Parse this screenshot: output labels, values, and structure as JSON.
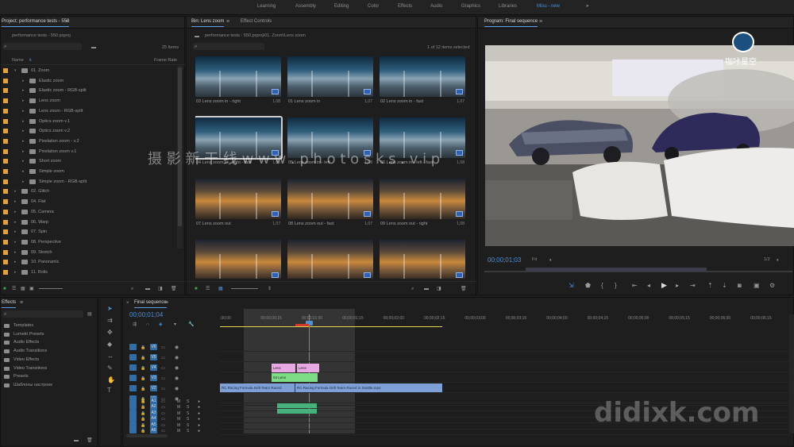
{
  "workspaces": [
    "Learning",
    "Assembly",
    "Editing",
    "Color",
    "Effects",
    "Audio",
    "Graphics",
    "Libraries",
    "Misu - new"
  ],
  "workspace_more": "»",
  "project": {
    "tab": "Project: performance tests - 550",
    "file": "performance tests - 550.prproj",
    "items_count": "25 Items",
    "col_name": "Name",
    "col_rate": "Frame Rate",
    "rows": [
      {
        "label": "01. Zoom",
        "level": 0,
        "open": true
      },
      {
        "label": "Elastic zoom",
        "level": 1
      },
      {
        "label": "Elastic zoom - RGB-split",
        "level": 1
      },
      {
        "label": "Lens zoom",
        "level": 1
      },
      {
        "label": "Lens zoom - RGB-split",
        "level": 1
      },
      {
        "label": "Optics zoom v.1",
        "level": 1
      },
      {
        "label": "Optics zoom v.2",
        "level": 1
      },
      {
        "label": "Pixelation zoom - v.2",
        "level": 1
      },
      {
        "label": "Pixelation zoom v.1",
        "level": 1
      },
      {
        "label": "Short zoom",
        "level": 1
      },
      {
        "label": "Simple zoom",
        "level": 1
      },
      {
        "label": "Simple zoom - RGB-split",
        "level": 1
      },
      {
        "label": "02. Glitch",
        "level": 0
      },
      {
        "label": "04. Flat",
        "level": 0
      },
      {
        "label": "05. Camera",
        "level": 0
      },
      {
        "label": "06. Warp",
        "level": 0
      },
      {
        "label": "07. Spin",
        "level": 0
      },
      {
        "label": "08. Perspective",
        "level": 0
      },
      {
        "label": "09. Stretch",
        "level": 0
      },
      {
        "label": "10. Panoramic",
        "level": 0
      },
      {
        "label": "11. Rolls",
        "level": 0
      }
    ]
  },
  "bin": {
    "tab": "Bin: Lens zoom",
    "tab2": "Effect Controls",
    "path": "performance tests - 550.prproj\\01. Zoom\\Lens zoom",
    "selected": "1 of 12 items selected",
    "thumbs": [
      {
        "caption": "03 Lens zoom in - right",
        "dur": "1,08",
        "style": "day"
      },
      {
        "caption": "01 Lens zoom in",
        "dur": "1,07",
        "style": "day"
      },
      {
        "caption": "02 Lens zoom in - fast",
        "dur": "1,07",
        "style": "day"
      },
      {
        "caption": "04 Lens zoom in - right - fast",
        "dur": "1,08",
        "style": "day",
        "selected": true
      },
      {
        "caption": "05 Lens zoom in - left",
        "dur": "1,08",
        "style": "day"
      },
      {
        "caption": "06 Lens zoom in - left - fast",
        "dur": "1,08",
        "style": "day"
      },
      {
        "caption": "07 Lens zoom out",
        "dur": "1,07",
        "style": "night"
      },
      {
        "caption": "08 Lens zoom out - fast",
        "dur": "1,07",
        "style": "night"
      },
      {
        "caption": "09 Lens zoom out - right",
        "dur": "1,08",
        "style": "night"
      },
      {
        "caption": "",
        "dur": "",
        "style": "night"
      },
      {
        "caption": "",
        "dur": "",
        "style": "night"
      },
      {
        "caption": "",
        "dur": "",
        "style": "night"
      }
    ]
  },
  "program": {
    "tab": "Program: Final sequence",
    "timecode": "00;00;01;03",
    "fit": "Fit",
    "resolution": "1/2"
  },
  "effects": {
    "tab": "Effects",
    "items": [
      "Templates",
      "Lumetri Presets",
      "Audio Effects",
      "Audio Transitions",
      "Video Effects",
      "Video Transitions",
      "Presets",
      "Шаблоны настроек"
    ]
  },
  "timeline": {
    "tab": "Final sequence",
    "timecode": "00;00;01;04",
    "ruler": [
      ";00;00",
      "00;00;00;15",
      "00;00;01;00",
      "00;00;01;15",
      "00;00;02;00",
      "00;00;02;15",
      "00;00;03;00",
      "00;00;03;15",
      "00;00;04;00",
      "00;00;04;15",
      "00;00;05;00",
      "00;00;05;15",
      "00;00;06;00",
      "00;00;06;15",
      "00;00;07;00"
    ],
    "video_tracks": [
      "V6",
      "V5",
      "V4",
      "V3",
      "V2",
      "V1"
    ],
    "audio_tracks": [
      "A1",
      "A2",
      "A3",
      "A4",
      "A5",
      "A6"
    ],
    "clip_lens_a": "Lens",
    "clip_lens_b": "Lens",
    "clip_lens_c": "04 Lens",
    "clip_v1_a": "RC Racing Formula Drift Team Raced",
    "clip_v1_b": "RC Racing Formula Drift Team Raced in Seattle.mp4"
  },
  "watermarks": {
    "center": "摄 影 新 干 线   w w w . p h o t o s k s . v i p",
    "logo_text": "咖咔星空",
    "corner": "didixk.com"
  },
  "colors": {
    "accent": "#4e8fd6",
    "bin_folder": "#e3a23a",
    "clip_pink": "#e8a8e4",
    "clip_green": "#7ddc86",
    "clip_blue": "#7fa0d6",
    "audio_green": "#44b27a",
    "playhead": "#4e8fd6"
  }
}
